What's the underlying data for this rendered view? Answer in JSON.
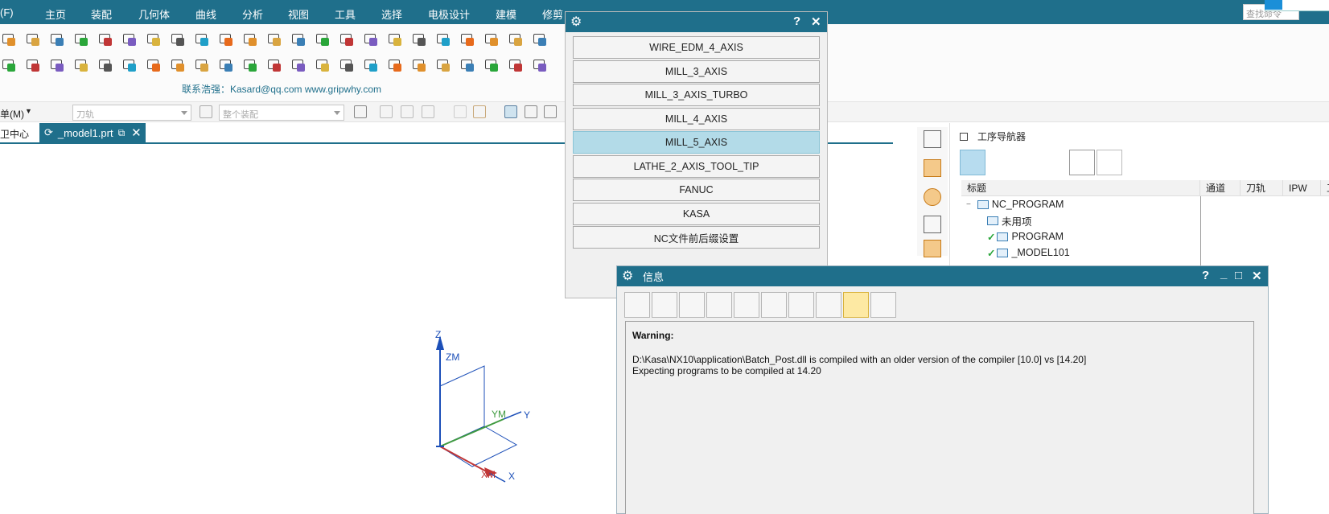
{
  "menu": {
    "items": [
      "(F)",
      "主页",
      "装配",
      "几何体",
      "曲线",
      "分析",
      "视图",
      "工具",
      "选择",
      "电极设计",
      "建模",
      "修剪"
    ],
    "search_placeholder": "查找命令"
  },
  "toolbar": {
    "contact_text": "联系浩强：Kasard@qq.com  www.gripwhy.com"
  },
  "selection_bar": {
    "menu_label": "单(M)",
    "filter_placeholder": "刀轨",
    "scope_placeholder": "整个装配"
  },
  "tabs": {
    "left_label": "卫中心",
    "active_label": "_model1.prt"
  },
  "post_dialog": {
    "options": [
      "WIRE_EDM_4_AXIS",
      "MILL_3_AXIS",
      "MILL_3_AXIS_TURBO",
      "MILL_4_AXIS",
      "MILL_5_AXIS",
      "LATHE_2_AXIS_TOOL_TIP",
      "FANUC",
      "KASA",
      "NC文件前后缀设置"
    ],
    "selected": "MILL_5_AXIS",
    "help_label": "?",
    "close_label": "✕"
  },
  "navigator": {
    "title": "工序导航器",
    "columns": [
      "标题",
      "通道",
      "刀轨",
      "IPW",
      "工"
    ],
    "rows": [
      {
        "label": "NC_PROGRAM",
        "indent": 0,
        "check": false,
        "expander": "−"
      },
      {
        "label": "未用项",
        "indent": 1,
        "check": false,
        "expander": ""
      },
      {
        "label": "PROGRAM",
        "indent": 1,
        "check": true,
        "expander": ""
      },
      {
        "label": "_MODEL101",
        "indent": 1,
        "check": true,
        "expander": ""
      }
    ]
  },
  "info_dialog": {
    "title": "信息",
    "warning_label": "Warning:",
    "lines": [
      "D:\\Kasa\\NX10\\application\\Batch_Post.dll is compiled with an older version of the compiler [10.0] vs [14.20]",
      "Expecting programs to be compiled at 14.20"
    ],
    "help_label": "?",
    "min_label": "_",
    "max_label": "□",
    "close_label": "✕"
  },
  "axes": {
    "z": "Z",
    "zm": "ZM",
    "y": "Y",
    "ym": "YM",
    "x": "X",
    "xm": "XM"
  },
  "colors": {
    "titlebar": "#1f6f8b",
    "selected_option": "#b3dbe8",
    "axis_z": "#1c4fb8",
    "axis_y": "#3f9a3f",
    "axis_x": "#c03636"
  }
}
